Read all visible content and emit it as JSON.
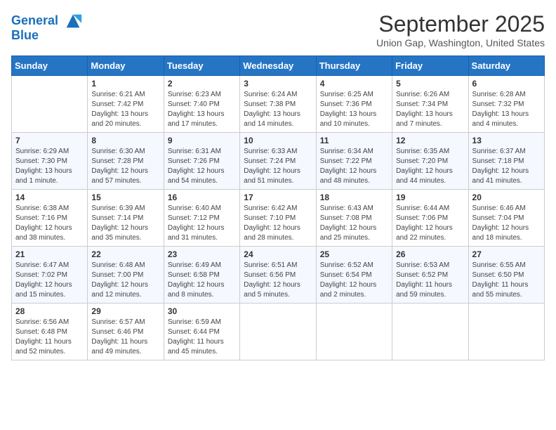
{
  "header": {
    "logo_line1": "General",
    "logo_line2": "Blue",
    "month": "September 2025",
    "location": "Union Gap, Washington, United States"
  },
  "weekdays": [
    "Sunday",
    "Monday",
    "Tuesday",
    "Wednesday",
    "Thursday",
    "Friday",
    "Saturday"
  ],
  "weeks": [
    [
      {
        "day": "",
        "info": ""
      },
      {
        "day": "1",
        "info": "Sunrise: 6:21 AM\nSunset: 7:42 PM\nDaylight: 13 hours\nand 20 minutes."
      },
      {
        "day": "2",
        "info": "Sunrise: 6:23 AM\nSunset: 7:40 PM\nDaylight: 13 hours\nand 17 minutes."
      },
      {
        "day": "3",
        "info": "Sunrise: 6:24 AM\nSunset: 7:38 PM\nDaylight: 13 hours\nand 14 minutes."
      },
      {
        "day": "4",
        "info": "Sunrise: 6:25 AM\nSunset: 7:36 PM\nDaylight: 13 hours\nand 10 minutes."
      },
      {
        "day": "5",
        "info": "Sunrise: 6:26 AM\nSunset: 7:34 PM\nDaylight: 13 hours\nand 7 minutes."
      },
      {
        "day": "6",
        "info": "Sunrise: 6:28 AM\nSunset: 7:32 PM\nDaylight: 13 hours\nand 4 minutes."
      }
    ],
    [
      {
        "day": "7",
        "info": "Sunrise: 6:29 AM\nSunset: 7:30 PM\nDaylight: 13 hours\nand 1 minute."
      },
      {
        "day": "8",
        "info": "Sunrise: 6:30 AM\nSunset: 7:28 PM\nDaylight: 12 hours\nand 57 minutes."
      },
      {
        "day": "9",
        "info": "Sunrise: 6:31 AM\nSunset: 7:26 PM\nDaylight: 12 hours\nand 54 minutes."
      },
      {
        "day": "10",
        "info": "Sunrise: 6:33 AM\nSunset: 7:24 PM\nDaylight: 12 hours\nand 51 minutes."
      },
      {
        "day": "11",
        "info": "Sunrise: 6:34 AM\nSunset: 7:22 PM\nDaylight: 12 hours\nand 48 minutes."
      },
      {
        "day": "12",
        "info": "Sunrise: 6:35 AM\nSunset: 7:20 PM\nDaylight: 12 hours\nand 44 minutes."
      },
      {
        "day": "13",
        "info": "Sunrise: 6:37 AM\nSunset: 7:18 PM\nDaylight: 12 hours\nand 41 minutes."
      }
    ],
    [
      {
        "day": "14",
        "info": "Sunrise: 6:38 AM\nSunset: 7:16 PM\nDaylight: 12 hours\nand 38 minutes."
      },
      {
        "day": "15",
        "info": "Sunrise: 6:39 AM\nSunset: 7:14 PM\nDaylight: 12 hours\nand 35 minutes."
      },
      {
        "day": "16",
        "info": "Sunrise: 6:40 AM\nSunset: 7:12 PM\nDaylight: 12 hours\nand 31 minutes."
      },
      {
        "day": "17",
        "info": "Sunrise: 6:42 AM\nSunset: 7:10 PM\nDaylight: 12 hours\nand 28 minutes."
      },
      {
        "day": "18",
        "info": "Sunrise: 6:43 AM\nSunset: 7:08 PM\nDaylight: 12 hours\nand 25 minutes."
      },
      {
        "day": "19",
        "info": "Sunrise: 6:44 AM\nSunset: 7:06 PM\nDaylight: 12 hours\nand 22 minutes."
      },
      {
        "day": "20",
        "info": "Sunrise: 6:46 AM\nSunset: 7:04 PM\nDaylight: 12 hours\nand 18 minutes."
      }
    ],
    [
      {
        "day": "21",
        "info": "Sunrise: 6:47 AM\nSunset: 7:02 PM\nDaylight: 12 hours\nand 15 minutes."
      },
      {
        "day": "22",
        "info": "Sunrise: 6:48 AM\nSunset: 7:00 PM\nDaylight: 12 hours\nand 12 minutes."
      },
      {
        "day": "23",
        "info": "Sunrise: 6:49 AM\nSunset: 6:58 PM\nDaylight: 12 hours\nand 8 minutes."
      },
      {
        "day": "24",
        "info": "Sunrise: 6:51 AM\nSunset: 6:56 PM\nDaylight: 12 hours\nand 5 minutes."
      },
      {
        "day": "25",
        "info": "Sunrise: 6:52 AM\nSunset: 6:54 PM\nDaylight: 12 hours\nand 2 minutes."
      },
      {
        "day": "26",
        "info": "Sunrise: 6:53 AM\nSunset: 6:52 PM\nDaylight: 11 hours\nand 59 minutes."
      },
      {
        "day": "27",
        "info": "Sunrise: 6:55 AM\nSunset: 6:50 PM\nDaylight: 11 hours\nand 55 minutes."
      }
    ],
    [
      {
        "day": "28",
        "info": "Sunrise: 6:56 AM\nSunset: 6:48 PM\nDaylight: 11 hours\nand 52 minutes."
      },
      {
        "day": "29",
        "info": "Sunrise: 6:57 AM\nSunset: 6:46 PM\nDaylight: 11 hours\nand 49 minutes."
      },
      {
        "day": "30",
        "info": "Sunrise: 6:59 AM\nSunset: 6:44 PM\nDaylight: 11 hours\nand 45 minutes."
      },
      {
        "day": "",
        "info": ""
      },
      {
        "day": "",
        "info": ""
      },
      {
        "day": "",
        "info": ""
      },
      {
        "day": "",
        "info": ""
      }
    ]
  ]
}
